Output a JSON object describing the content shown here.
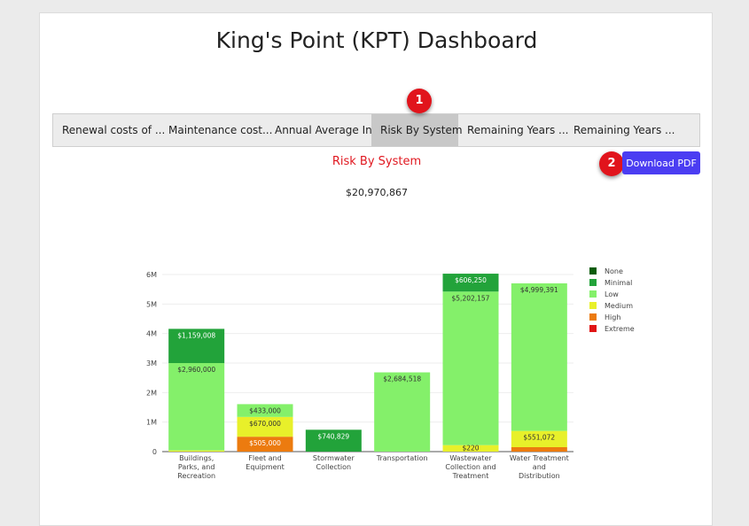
{
  "title": "King's Point (KPT) Dashboard",
  "tabs": [
    {
      "label": "Renewal costs of ..."
    },
    {
      "label": "Maintenance cost..."
    },
    {
      "label": "Annual Average In..."
    },
    {
      "label": "Risk By System",
      "active": true
    },
    {
      "label": "Remaining Years ..."
    },
    {
      "label": "Remaining Years ..."
    }
  ],
  "markers": [
    "1",
    "2"
  ],
  "section_title": "Risk By System",
  "download_label": "Download PDF",
  "total": "$20,970,867",
  "colors": {
    "None": "#0a5c0a",
    "Minimal": "#22a33a",
    "Low": "#84f06a",
    "Medium": "#e8f02a",
    "High": "#ec7b0f",
    "Extreme": "#e01414",
    "button": "#4b3df2",
    "marker": "#e1141c"
  },
  "chart_data": {
    "type": "bar",
    "stacked": true,
    "categories": [
      "Buildings, Parks, and Recreation",
      "Fleet and Equipment",
      "Stormwater Collection",
      "Transportation",
      "Wastewater Collection and Treatment",
      "Water Treatment and Distribution"
    ],
    "category_lines": [
      [
        "Buildings,",
        "Parks, and",
        "Recreation"
      ],
      [
        "Fleet and",
        "Equipment"
      ],
      [
        "Stormwater",
        "Collection"
      ],
      [
        "Transportation"
      ],
      [
        "Wastewater",
        "Collection and",
        "Treatment"
      ],
      [
        "Water Treatment",
        "and",
        "Distribution"
      ]
    ],
    "series": [
      {
        "name": "None",
        "values": [
          0,
          0,
          0,
          0,
          0,
          0
        ]
      },
      {
        "name": "Minimal",
        "values": [
          1159008,
          0,
          740829,
          0,
          606250,
          0
        ]
      },
      {
        "name": "Low",
        "values": [
          2960000,
          433000,
          0,
          2684518,
          5202157,
          4999391
        ]
      },
      {
        "name": "Medium",
        "values": [
          40000,
          670000,
          0,
          0,
          220000,
          551072
        ]
      },
      {
        "name": "High",
        "values": [
          0,
          505000,
          0,
          0,
          0,
          150000
        ]
      },
      {
        "name": "Extreme",
        "values": [
          0,
          0,
          0,
          0,
          0,
          0
        ]
      }
    ],
    "data_labels": [
      {
        "Minimal": "$1,159,008",
        "Low": "$2,960,000"
      },
      {
        "Low": "$433,000",
        "Medium": "$670,000",
        "High": "$505,000"
      },
      {
        "Minimal": "$740,829"
      },
      {
        "Low": "$2,684,518"
      },
      {
        "Minimal": "$606,250",
        "Low": "$5,202,157",
        "Medium": "$220"
      },
      {
        "Low": "$4,999,391",
        "Medium": "$551,072"
      }
    ],
    "ylim": [
      0,
      6000000
    ],
    "yticks": [
      {
        "v": 0,
        "label": "0"
      },
      {
        "v": 1000000,
        "label": "1M"
      },
      {
        "v": 2000000,
        "label": "2M"
      },
      {
        "v": 3000000,
        "label": "3M"
      },
      {
        "v": 4000000,
        "label": "4M"
      },
      {
        "v": 5000000,
        "label": "5M"
      },
      {
        "v": 6000000,
        "label": "6M"
      }
    ],
    "legend": [
      "None",
      "Minimal",
      "Low",
      "Medium",
      "High",
      "Extreme"
    ],
    "legend_position": "right",
    "grid": true
  }
}
